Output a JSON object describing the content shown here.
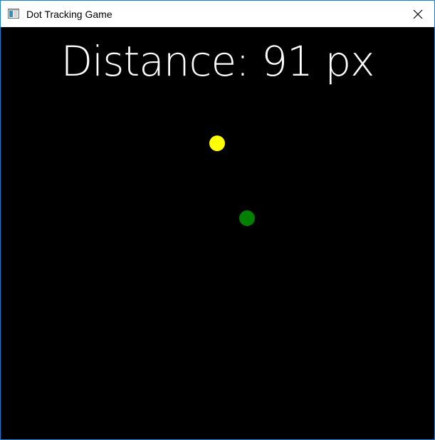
{
  "window": {
    "title": "Dot Tracking Game",
    "app_icon": "window-app-icon",
    "close_icon": "close-icon"
  },
  "game": {
    "distance_label": "Distance:",
    "distance_value": 91,
    "distance_unit": "px",
    "distance_text": "Distance: 91 px",
    "background_color": "#000000",
    "target_dot_color": "#ffff00",
    "player_dot_color": "#008000"
  }
}
